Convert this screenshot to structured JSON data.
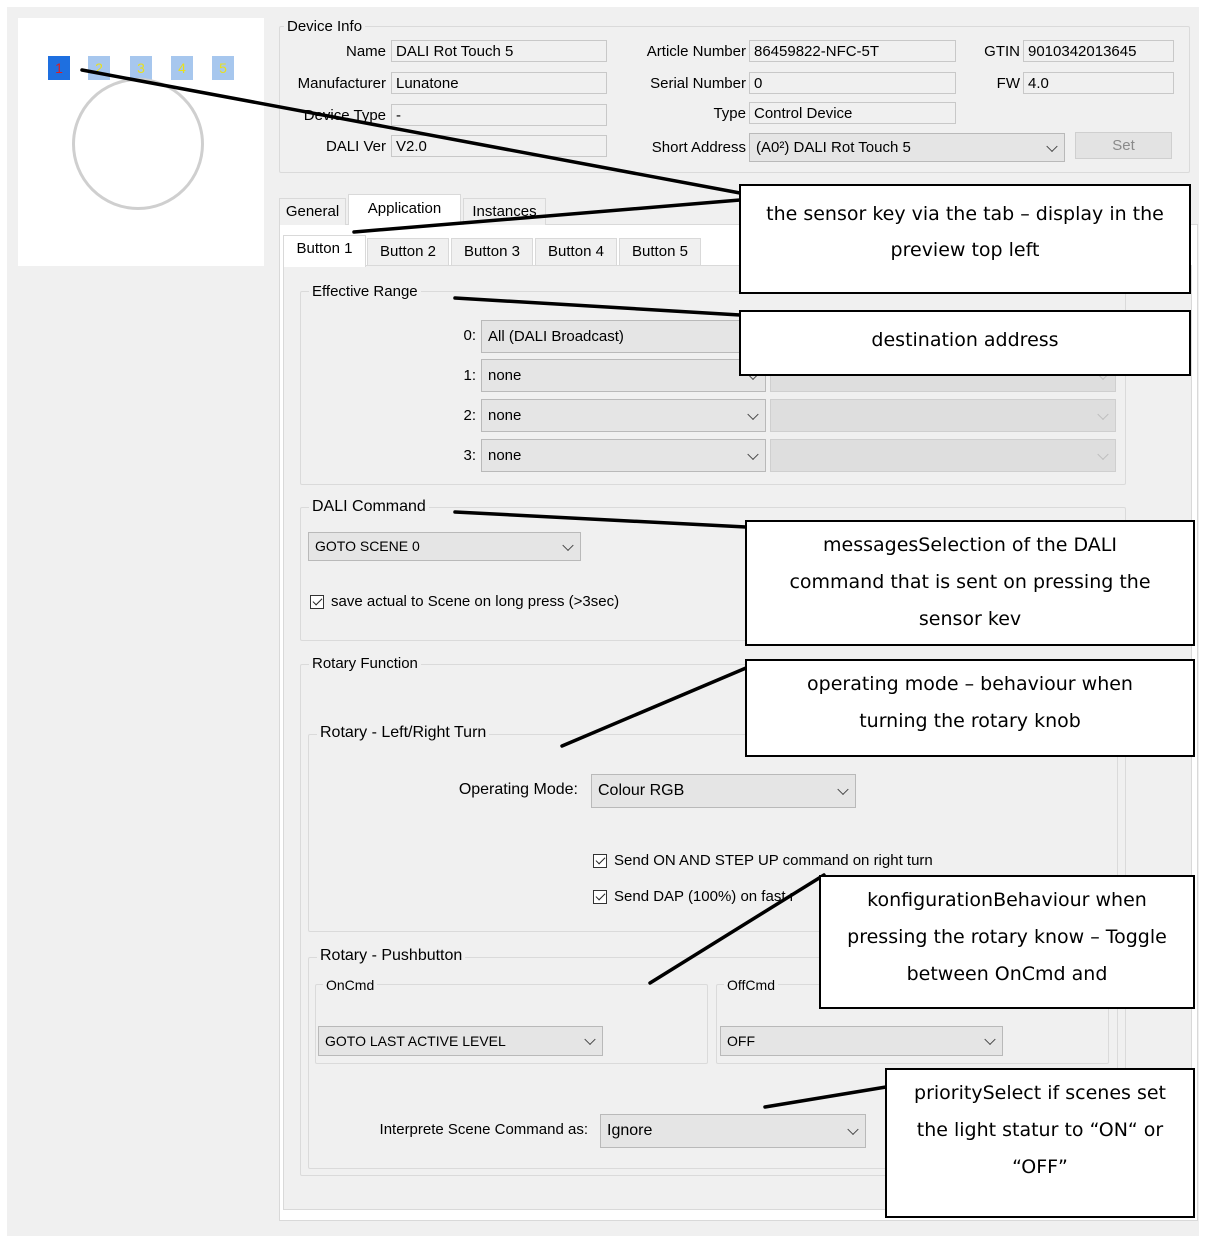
{
  "preview": {
    "keys": [
      "1",
      "2",
      "3",
      "4",
      "5"
    ],
    "selected_key": "1"
  },
  "device_info": {
    "title": "Device Info",
    "name_label": "Name",
    "name_value": "DALI Rot Touch 5",
    "manufacturer_label": "Manufacturer",
    "manufacturer_value": "Lunatone",
    "device_type_label": "Device Type",
    "device_type_value": "-",
    "dali_ver_label": "DALI Ver",
    "dali_ver_value": "V2.0",
    "article_number_label": "Article Number",
    "article_number_value": "86459822-NFC-5T",
    "serial_number_label": "Serial Number",
    "serial_number_value": "0",
    "type_label": "Type",
    "type_value": "Control Device",
    "short_address_label": "Short Address",
    "short_address_value": "(A0²) DALI Rot Touch 5",
    "gtin_label": "GTIN",
    "gtin_value": "9010342013645",
    "fw_label": "FW",
    "fw_value": "4.0",
    "set_button": "Set"
  },
  "tabs": [
    "General",
    "Application",
    "Instances"
  ],
  "button_tabs": [
    "Button 1",
    "Button 2",
    "Button 3",
    "Button 4",
    "Button 5"
  ],
  "effective_range": {
    "title": "Effective Range",
    "rows": [
      {
        "index": "0:",
        "value": "All (DALI Broadcast)"
      },
      {
        "index": "1:",
        "value": "none"
      },
      {
        "index": "2:",
        "value": "none"
      },
      {
        "index": "3:",
        "value": "none"
      }
    ]
  },
  "dali_command": {
    "title": "DALI Command",
    "value": "GOTO SCENE 0",
    "checkbox_label": "save actual to Scene on long press (>3sec)"
  },
  "rotary_function": {
    "title": "Rotary Function",
    "turn": {
      "title": "Rotary - Left/Right Turn",
      "operating_mode_label": "Operating Mode:",
      "operating_mode_value": "Colour RGB",
      "checkbox1_label": "Send ON AND STEP UP command on right turn",
      "checkbox2_label": "Send DAP (100%) on fast r"
    },
    "pushbutton": {
      "title": "Rotary - Pushbutton",
      "oncmd_title": "OnCmd",
      "oncmd_value": "GOTO LAST ACTIVE LEVEL",
      "offcmd_title": "OffCmd",
      "offcmd_value": "OFF",
      "interprete_label": "Interprete Scene Command as:",
      "interprete_value": "Ignore"
    }
  },
  "callouts": {
    "sensor_key": "the sensor key via the tab – display in the preview top left",
    "destination": "destination address",
    "messages": "messagesSelection of the DALI command that is sent on pressing the sensor kev",
    "operating_mode": "operating mode – behaviour when turning the rotary knob",
    "konfiguration": "konfigurationBehaviour when pressing the rotary know – Toggle between OnCmd and",
    "priority": "prioritySelect if scenes set the light statur to “ON“ or “OFF”"
  }
}
